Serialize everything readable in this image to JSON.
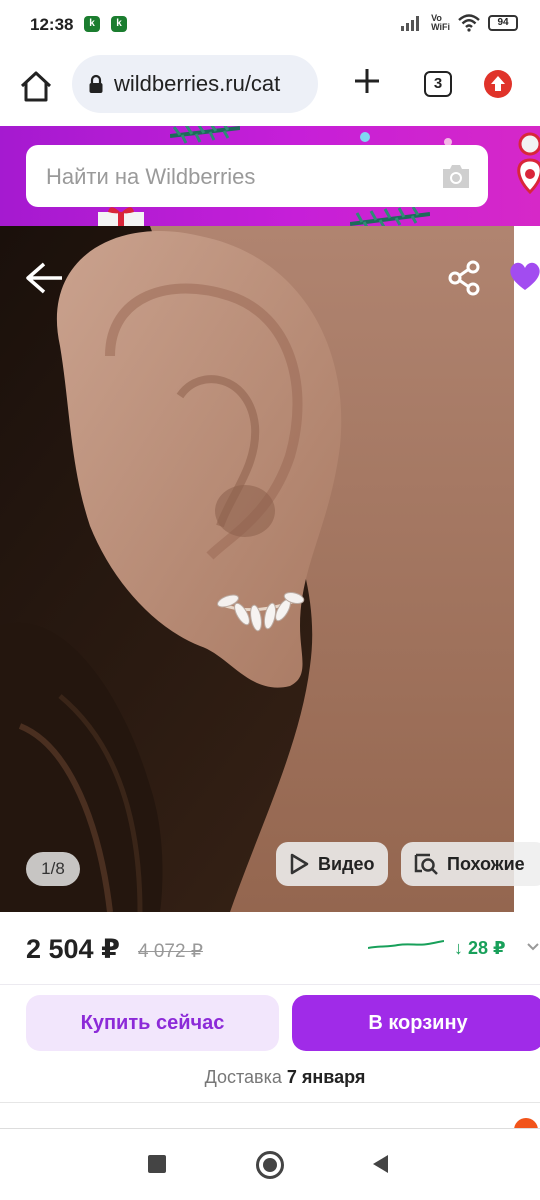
{
  "status": {
    "time": "12:38",
    "k_badge": "k",
    "vowifi": "Vo\nWiFi",
    "battery": "94"
  },
  "browser": {
    "url": "wildberries.ru/cat",
    "tab_count": "3"
  },
  "header": {
    "search_placeholder": "Найти на Wildberries"
  },
  "gallery": {
    "counter": "1/8",
    "video_label": "Видео",
    "similar_label": "Похожие"
  },
  "pricing": {
    "price": "2 504 ₽",
    "old_price": "4 072 ₽",
    "price_drop": "↓ 28 ₽",
    "trend_color": "#18a05a"
  },
  "actions": {
    "buy_now": "Купить сейчас",
    "add_to_cart": "В корзину",
    "delivery_prefix": "Доставка",
    "delivery_date": "7 января"
  },
  "theme": {
    "brand": "#a02be8",
    "header_gradient": [
      "#a51ad0",
      "#d628c8"
    ]
  }
}
